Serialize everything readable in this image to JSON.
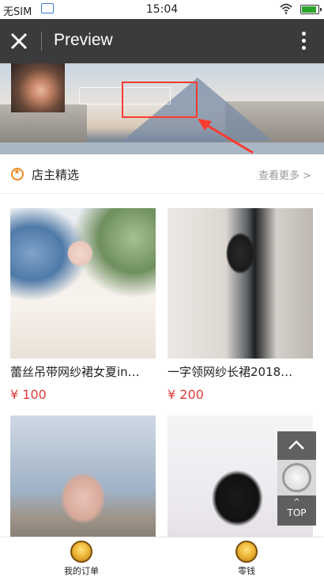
{
  "status_bar": {
    "carrier": "无SIM",
    "time": "15:04"
  },
  "title_bar": {
    "title": "Preview"
  },
  "section": {
    "title": "店主精选",
    "more": "查看更多 >"
  },
  "products": [
    {
      "name": "蕾丝吊带网纱裙女夏in…",
      "price": "¥ 100"
    },
    {
      "name": "一字领网纱长裙2018…",
      "price": "¥ 200"
    },
    {
      "name": "",
      "price": ""
    },
    {
      "name": "",
      "price": ""
    }
  ],
  "floating": {
    "top_label": "TOP"
  },
  "bottom_nav": {
    "tabs": [
      {
        "label": "我的订单"
      },
      {
        "label": "零钱"
      }
    ]
  },
  "colors": {
    "accent": "#f08a24",
    "price": "#e23b3b",
    "titlebar": "#3b3b3b",
    "highlight": "#ff3b30"
  }
}
